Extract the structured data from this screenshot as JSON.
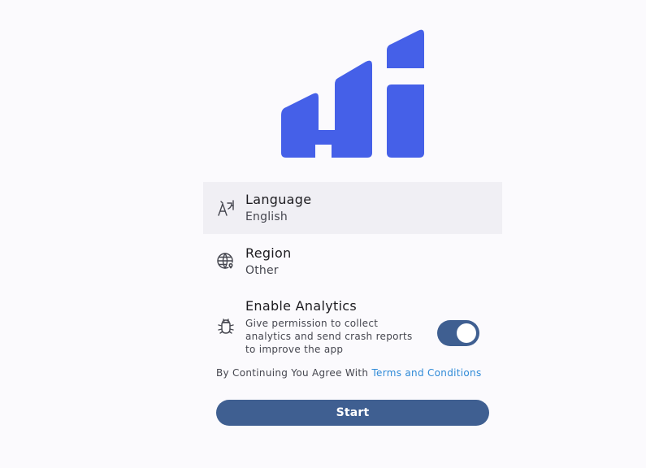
{
  "brand": {
    "logo": "hi-logo-icon",
    "color": "#4560e8"
  },
  "settings": {
    "language": {
      "icon": "translate-icon",
      "title": "Language",
      "value": "English"
    },
    "region": {
      "icon": "globe-location-icon",
      "title": "Region",
      "value": "Other"
    },
    "analytics": {
      "icon": "bug-icon",
      "title": "Enable Analytics",
      "description": "Give permission to collect analytics and send crash reports to improve the app",
      "enabled": true
    }
  },
  "terms": {
    "prefix": "By Continuing You Agree With ",
    "link_label": "Terms and Conditions"
  },
  "start_button": {
    "label": "Start"
  },
  "colors": {
    "background": "#fbfafd",
    "selected_row": "#f0eff4",
    "primary": "#3f5f91",
    "link": "#2f8ad7",
    "logo": "#4560e8"
  }
}
